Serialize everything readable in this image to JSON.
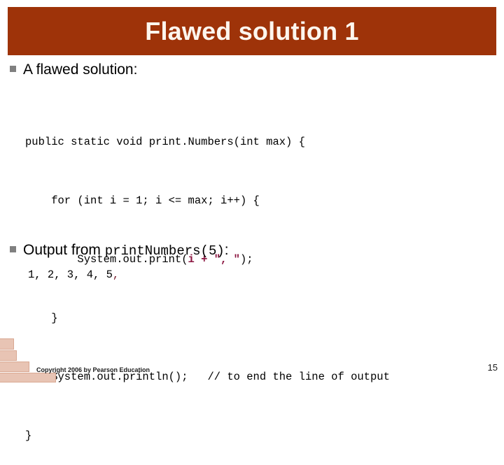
{
  "slide": {
    "title": "Flawed solution 1",
    "page_number": "15",
    "copyright": "Copyright 2006 by Pearson Education",
    "accent_color": "#9e3309",
    "title_text_color": "#fdf6ee",
    "bullet_marker_color": "#808080",
    "code_highlight_color": "#8c1742",
    "decor_block_color": "#e8c4b4"
  },
  "bullets": [
    {
      "label": "A flawed solution:"
    },
    {
      "label_prefix": "Output from ",
      "label_code": "printNumbers(5)",
      "label_suffix": ":"
    }
  ],
  "code": {
    "line1": "public static void print.Numbers(int max) {",
    "line2": "    for (int i = 1; i <= max; i++) {",
    "line3_prefix": "        System.out.print(",
    "line3_highlight": "i + \", \"",
    "line3_suffix": ");",
    "line4": "    }",
    "line5": "    System.out.println();   // to end the line of output",
    "line6": "}"
  },
  "output": {
    "values": "1, 2, 3, 4, 5",
    "trailing_comma": ","
  }
}
